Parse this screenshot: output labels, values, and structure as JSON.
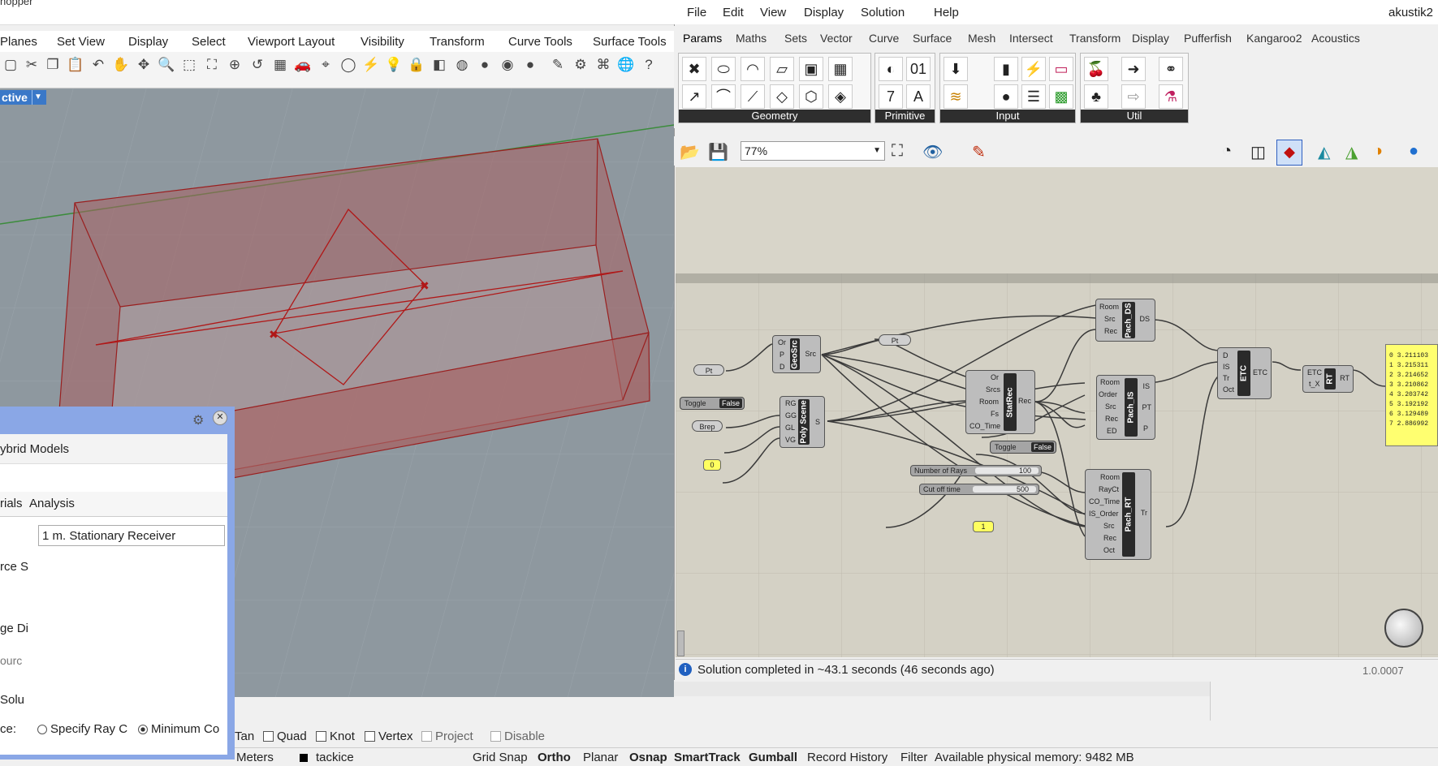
{
  "rhino": {
    "title": "hopper",
    "menu": [
      "Planes",
      "Set View",
      "Display",
      "Select",
      "Viewport Layout",
      "Visibility",
      "Transform",
      "Curve Tools",
      "Surface Tools"
    ],
    "viewport_label": "ctive",
    "osnap": {
      "items": [
        {
          "label": "Tan",
          "checked": false
        },
        {
          "label": "Quad",
          "checked": false
        },
        {
          "label": "Knot",
          "checked": false
        },
        {
          "label": "Vertex",
          "checked": false
        },
        {
          "label": "Project",
          "checked": false
        },
        {
          "label": "Disable",
          "checked": false
        }
      ]
    },
    "status": {
      "units": "Meters",
      "layer": "tackice",
      "grid_snap": "Grid Snap",
      "ortho": "Ortho",
      "planar": "Planar",
      "osnap": "Osnap",
      "smarttrack": "SmartTrack",
      "gumball": "Gumball",
      "record_history": "Record History",
      "filter": "Filter",
      "memory": "Available physical memory: 9482 MB"
    }
  },
  "pachyderm": {
    "header": "ybrid Models",
    "tabs": [
      "rials",
      "Analysis"
    ],
    "receiver_value": "1 m. Stationary Receiver",
    "labels": [
      "rce S",
      "ge Di",
      "ourc",
      "Solu",
      "ce:"
    ],
    "radio_specify": "Specify Ray C",
    "radio_minimum": "Minimum Co"
  },
  "gh": {
    "menu": [
      "File",
      "Edit",
      "View",
      "Display",
      "Solution",
      "Help"
    ],
    "user": "akustik2",
    "tabs": [
      "Params",
      "Maths",
      "Sets",
      "Vector",
      "Curve",
      "Surface",
      "Mesh",
      "Intersect",
      "Transform",
      "Display",
      "Pufferfish",
      "Kangaroo2",
      "Acoustics"
    ],
    "groups": [
      "Geometry",
      "Primitive",
      "Input",
      "Util"
    ],
    "zoom": "77%",
    "status_text": "Solution completed in ~43.1 seconds (46 seconds ago)",
    "version": "1.0.0007",
    "components": {
      "geosrc": {
        "name": "GeoSrc",
        "inputs": [
          "Or",
          "P",
          "D"
        ],
        "output": "Src"
      },
      "polyscene": {
        "name": "Poly Scene",
        "inputs": [
          "RG",
          "GG",
          "GL",
          "VG"
        ],
        "output": "S"
      },
      "statrec": {
        "name": "StatRec",
        "inputs": [
          "Or",
          "Srcs",
          "Room",
          "Fs",
          "CO_Time"
        ],
        "output": "Rec"
      },
      "pachds": {
        "name": "Pach_DS",
        "inputs": [
          "Room",
          "Src",
          "Rec"
        ],
        "output": "DS"
      },
      "pachis": {
        "name": "Pach_IS",
        "inputs": [
          "Room",
          "Order",
          "Src",
          "Rec",
          "ED"
        ],
        "outputs": [
          "IS",
          "PT",
          "P"
        ]
      },
      "pachrt": {
        "name": "Pach_RT",
        "inputs": [
          "Room",
          "RayCt",
          "CO_Time",
          "IS_Order",
          "Src",
          "Rec",
          "Oct"
        ],
        "output": "Tr"
      },
      "etc": {
        "name": "ETC",
        "inputs": [
          "D",
          "IS",
          "Tr",
          "Oct"
        ],
        "output": "ETC"
      },
      "rt": {
        "name": "RT",
        "inputs": [
          "ETC",
          "t_X"
        ],
        "output": "RT"
      }
    },
    "params": {
      "pt1": "Pt",
      "pt2": "Pt",
      "brep": "Brep",
      "toggle1_label": "Toggle",
      "toggle1_value": "False",
      "toggle2_label": "Toggle",
      "toggle2_value": "False",
      "num0": "0",
      "num1": "1",
      "slider_rays_label": "Number of Rays",
      "slider_rays_value": "100",
      "slider_cut_label": "Cut off time",
      "slider_cut_value": "500"
    },
    "panel_rows": [
      "0 3.211103",
      "1 3.215311",
      "2 3.214652",
      "3 3.210862",
      "4 3.203742",
      "5 3.192192",
      "6 3.129489",
      "7 2.886992"
    ]
  }
}
